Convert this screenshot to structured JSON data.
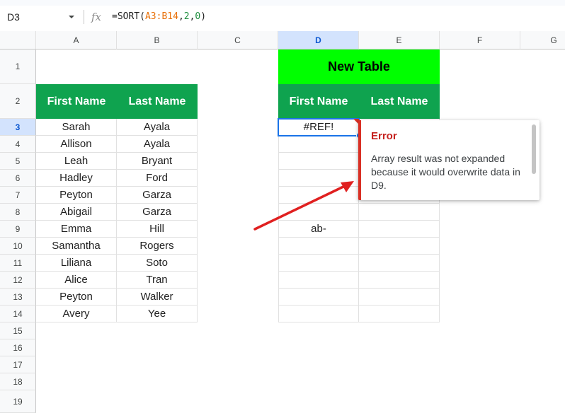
{
  "formula_bar": {
    "name_box": "D3",
    "fx": "fx",
    "formula_prefix": "=SORT(",
    "formula_range": "A3:B14",
    "formula_sep1": ",",
    "formula_arg2": "2",
    "formula_sep2": ",",
    "formula_arg3": "0",
    "formula_suffix": ")"
  },
  "columns": [
    "A",
    "B",
    "C",
    "D",
    "E",
    "F",
    "G"
  ],
  "rows": [
    "1",
    "2",
    "3",
    "4",
    "5",
    "6",
    "7",
    "8",
    "9",
    "10",
    "11",
    "12",
    "13",
    "14",
    "15",
    "16",
    "17",
    "18",
    "19"
  ],
  "source_table": {
    "headers": [
      "First Name",
      "Last Name"
    ],
    "rows": [
      [
        "Sarah",
        "Ayala"
      ],
      [
        "Allison",
        "Ayala"
      ],
      [
        "Leah",
        "Bryant"
      ],
      [
        "Hadley",
        "Ford"
      ],
      [
        "Peyton",
        "Garza"
      ],
      [
        "Abigail",
        "Garza"
      ],
      [
        "Emma",
        "Hill"
      ],
      [
        "Samantha",
        "Rogers"
      ],
      [
        "Liliana",
        "Soto"
      ],
      [
        "Alice",
        "Tran"
      ],
      [
        "Peyton",
        "Walker"
      ],
      [
        "Avery",
        "Yee"
      ]
    ]
  },
  "new_table": {
    "title": "New Table",
    "headers": [
      "First Name",
      "Last Name"
    ],
    "d3_value": "#REF!",
    "d9_value": "ab-"
  },
  "error_popup": {
    "title": "Error",
    "message": "Array result was not expanded because it would overwrite data in D9."
  },
  "colors": {
    "header_green": "#0fa34f",
    "title_green": "#00ff00",
    "error_red": "#d93025",
    "selection_blue": "#1a73e8"
  }
}
